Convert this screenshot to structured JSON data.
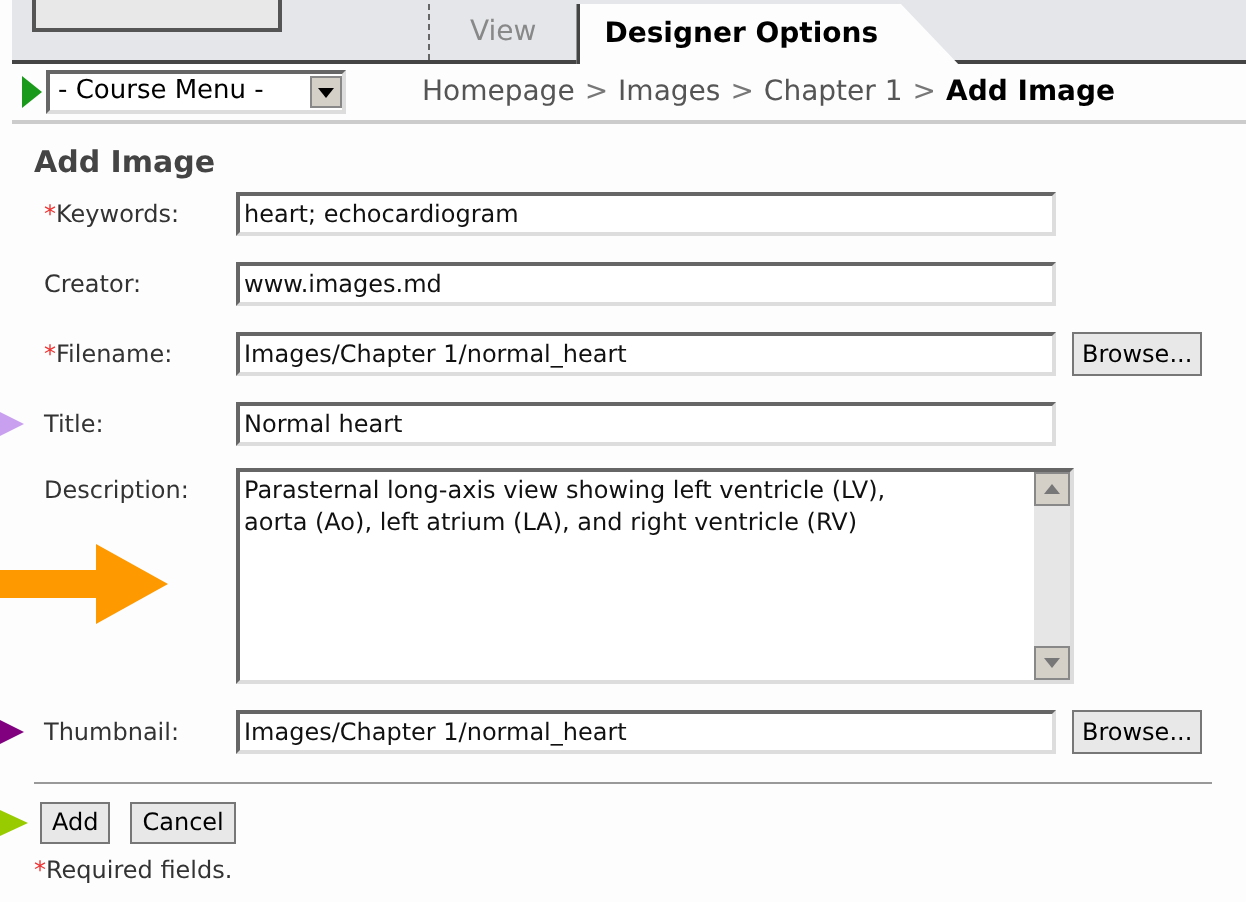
{
  "tabs": [
    {
      "label": "View",
      "selected": false
    },
    {
      "label": "Designer Options",
      "selected": true
    }
  ],
  "course_menu": {
    "value": "- Course Menu -"
  },
  "breadcrumb": [
    {
      "label": "Homepage",
      "current": false
    },
    {
      "label": "Images",
      "current": false
    },
    {
      "label": "Chapter 1",
      "current": false
    },
    {
      "label": "Add Image",
      "current": true
    }
  ],
  "breadcrumb_separator": ">",
  "form": {
    "title": "Add Image",
    "fields": [
      {
        "kind": "text",
        "label": "Keywords:",
        "required": true,
        "value": "heart; echocardiogram"
      },
      {
        "kind": "text",
        "label": "Creator:",
        "required": false,
        "value": "www.images.md"
      },
      {
        "kind": "file",
        "label": "Filename:",
        "required": true,
        "value": "Images/Chapter 1/normal_heart",
        "button": "Browse..."
      },
      {
        "kind": "text",
        "label": "Title:",
        "required": false,
        "value": "Normal heart",
        "pointer": {
          "color": "#c9a0f0",
          "kind": "triangle"
        }
      },
      {
        "kind": "textarea",
        "label": "Description:",
        "required": false,
        "value": "Parasternal long-axis view showing left ventricle (LV), aorta (Ao), left atrium (LA), and right ventricle (RV)",
        "pointer": {
          "color": "#ff9900",
          "kind": "arrow"
        }
      },
      {
        "kind": "file",
        "label": "Thumbnail:",
        "required": false,
        "value": "Images/Chapter 1/normal_heart",
        "button": "Browse...",
        "pointer": {
          "color": "#800080",
          "kind": "triangle"
        }
      }
    ],
    "required_mark": "*",
    "buttons": [
      {
        "label": "Add"
      },
      {
        "label": "Cancel"
      }
    ],
    "buttons_pointer": {
      "color": "#99cc00",
      "kind": "triangle"
    },
    "note": "Required fields."
  }
}
